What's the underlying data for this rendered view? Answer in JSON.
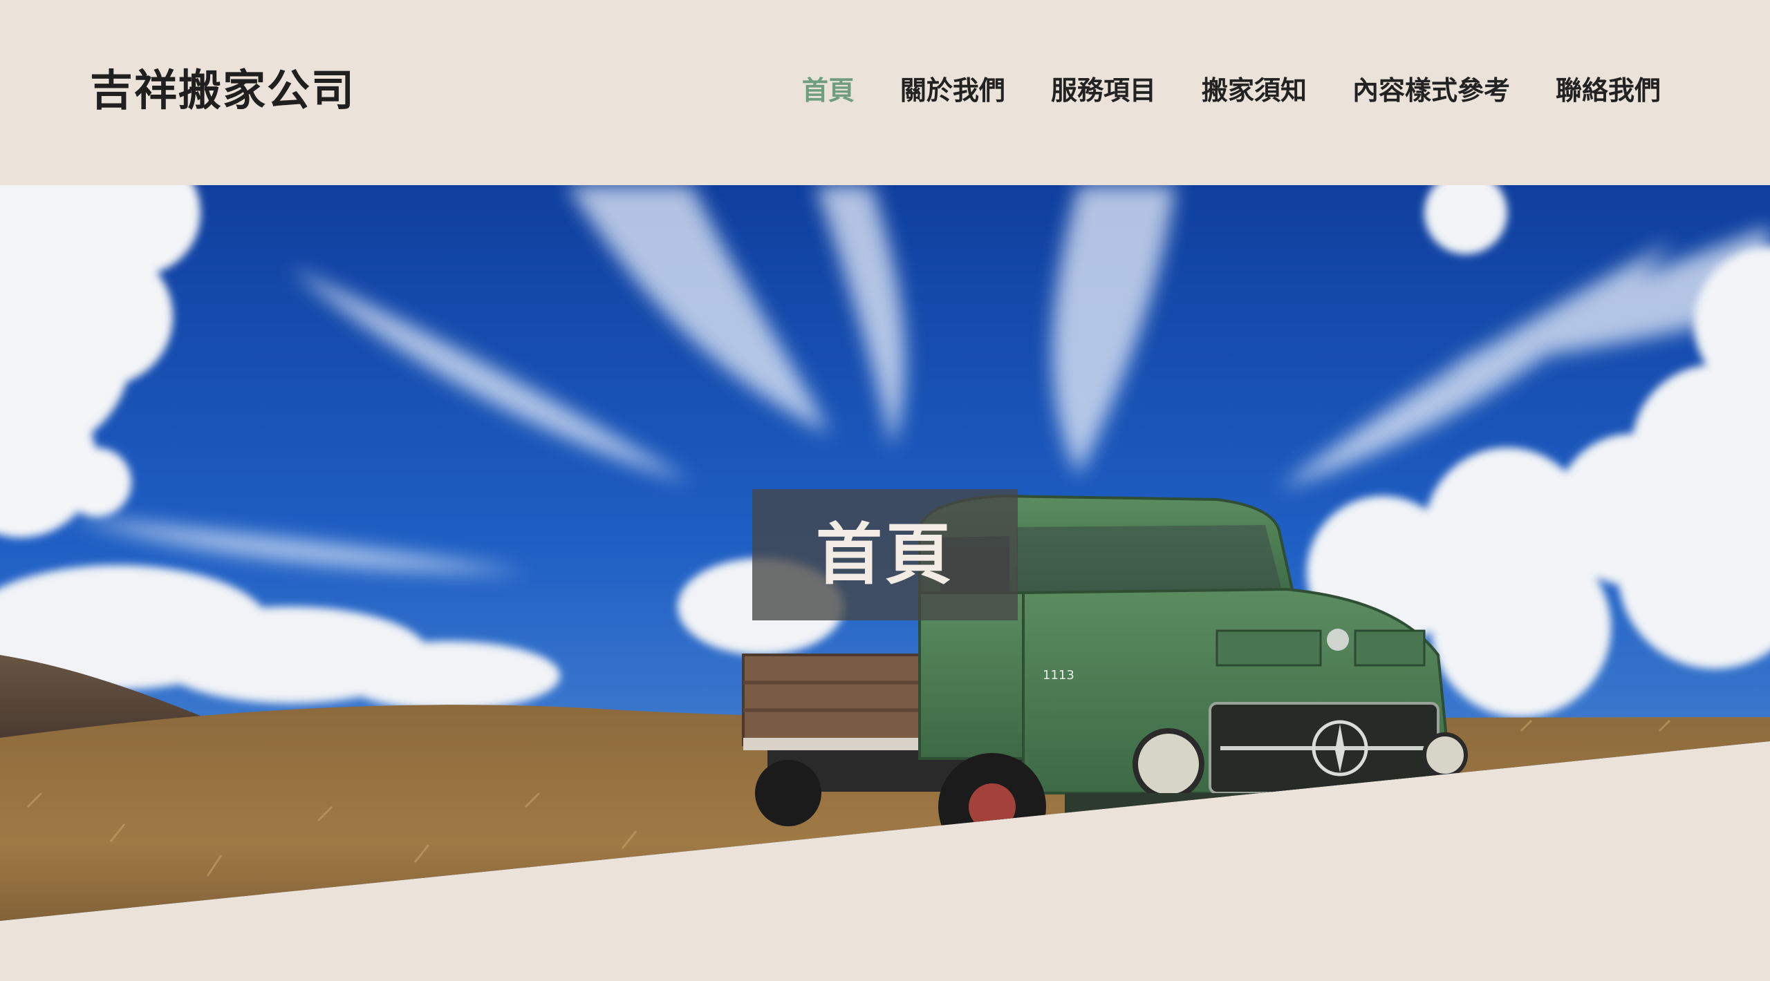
{
  "site": {
    "title": "吉祥搬家公司"
  },
  "nav": {
    "items": [
      {
        "label": "首頁",
        "active": true
      },
      {
        "label": "關於我們",
        "active": false
      },
      {
        "label": "服務項目",
        "active": false
      },
      {
        "label": "搬家須知",
        "active": false
      },
      {
        "label": "內容樣式參考",
        "active": false
      },
      {
        "label": "聯絡我們",
        "active": false
      }
    ]
  },
  "hero": {
    "title": "首頁",
    "truck_badge": "1113"
  },
  "colors": {
    "page_background": "#ebe3da",
    "nav_active": "#6f9e7e",
    "nav_text": "#222222",
    "hero_overlay": "#464646",
    "sky": "#1f5fc4",
    "truck_green": "#4f7f55"
  }
}
